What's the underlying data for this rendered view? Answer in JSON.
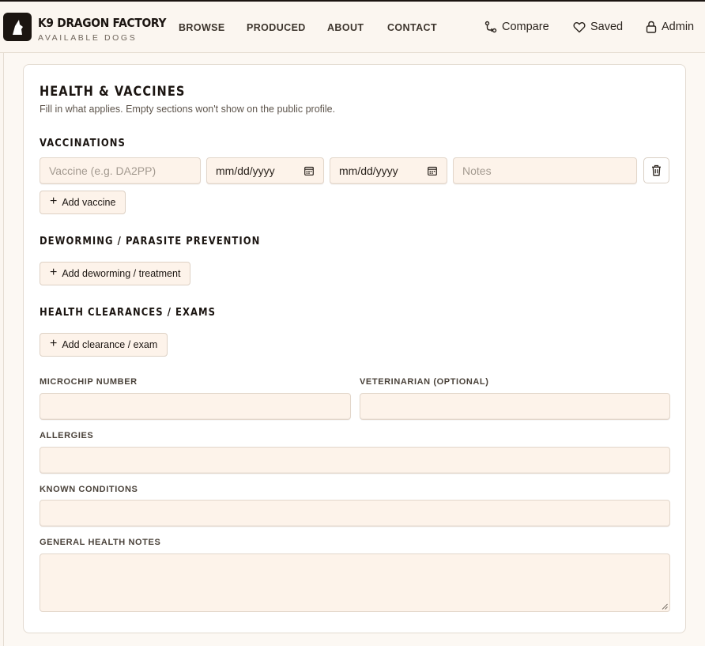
{
  "header": {
    "brand_name": "K9 DRAGON FACTORY",
    "brand_sub": "AVAILABLE DOGS",
    "nav": [
      "BROWSE",
      "PRODUCED",
      "ABOUT",
      "CONTACT"
    ],
    "actions": {
      "compare": "Compare",
      "saved": "Saved",
      "admin": "Admin"
    }
  },
  "card": {
    "title": "HEALTH & VACCINES",
    "subtitle": "Fill in what applies. Empty sections won't show on the public profile.",
    "vaccinations": {
      "title": "VACCINATIONS",
      "row": {
        "vaccine_placeholder": "Vaccine (e.g. DA2PP)",
        "date1": "mm/dd/yyyy",
        "date2": "mm/dd/yyyy",
        "notes_placeholder": "Notes"
      },
      "add_label": "Add vaccine"
    },
    "deworming": {
      "title": "DEWORMING / PARASITE PREVENTION",
      "add_label": "Add deworming / treatment"
    },
    "clearances": {
      "title": "HEALTH CLEARANCES / EXAMS",
      "add_label": "Add clearance / exam"
    },
    "fields": {
      "microchip": "MICROCHIP NUMBER",
      "veterinarian": "VETERINARIAN (OPTIONAL)",
      "allergies": "ALLERGIES",
      "known_conditions": "KNOWN CONDITIONS",
      "general_notes": "GENERAL HEALTH NOTES"
    }
  },
  "colors": {
    "brand_dark": "#1b1511",
    "field_bg": "#fdf3ea",
    "page_bg": "#fbf6f0"
  }
}
